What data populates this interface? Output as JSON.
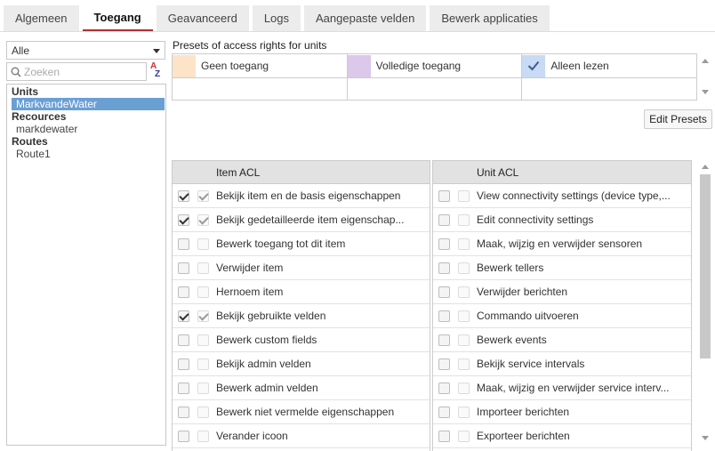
{
  "tabs": [
    {
      "label": "Algemeen",
      "active": false
    },
    {
      "label": "Toegang",
      "active": true
    },
    {
      "label": "Geavanceerd",
      "active": false
    },
    {
      "label": "Logs",
      "active": false
    },
    {
      "label": "Aangepaste velden",
      "active": false
    },
    {
      "label": "Bewerk applicaties",
      "active": false
    }
  ],
  "filter": {
    "selected": "Alle"
  },
  "search": {
    "placeholder": "Zoeken"
  },
  "sort_icon": {
    "top": "A",
    "bottom": "Z"
  },
  "tree": {
    "units_label": "Units",
    "unit_item": "MarkvandeWater",
    "resources_label": "Recources",
    "resource_item": "markdewater",
    "routes_label": "Routes",
    "route_item": "Route1"
  },
  "presets": {
    "title": "Presets of access rights for units",
    "items": [
      {
        "label": "Geen toegang",
        "color": "#fde3c8"
      },
      {
        "label": "Volledige toegang",
        "color": "#dcc8ea"
      },
      {
        "label": "Alleen lezen",
        "color": "#c8daf4",
        "checked": true
      }
    ]
  },
  "edit_presets_label": "Edit Presets",
  "item_acl": {
    "header": "Item ACL",
    "rows": [
      {
        "label": "Bekijk item en de basis eigenschappen",
        "checked": true
      },
      {
        "label": "Bekijk gedetailleerde item eigenschap...",
        "checked": true
      },
      {
        "label": "Bewerk toegang tot dit item",
        "checked": false
      },
      {
        "label": "Verwijder item",
        "checked": false
      },
      {
        "label": "Hernoem item",
        "checked": false
      },
      {
        "label": "Bekijk gebruikte velden",
        "checked": true
      },
      {
        "label": "Bewerk custom fields",
        "checked": false
      },
      {
        "label": "Bekijk admin velden",
        "checked": false
      },
      {
        "label": "Bewerk admin velden",
        "checked": false
      },
      {
        "label": "Bewerk niet vermelde eigenschappen",
        "checked": false
      },
      {
        "label": "Verander icoon",
        "checked": false
      }
    ]
  },
  "unit_acl": {
    "header": "Unit ACL",
    "rows": [
      {
        "label": "View connectivity settings (device type,...",
        "checked": false
      },
      {
        "label": "Edit connectivity settings",
        "checked": false
      },
      {
        "label": "Maak, wijzig en verwijder sensoren",
        "checked": false
      },
      {
        "label": "Bewerk tellers",
        "checked": false
      },
      {
        "label": "Verwijder berichten",
        "checked": false
      },
      {
        "label": "Commando uitvoeren",
        "checked": false
      },
      {
        "label": "Bewerk events",
        "checked": false
      },
      {
        "label": "Bekijk service intervals",
        "checked": false
      },
      {
        "label": "Maak, wijzig en verwijder service interv...",
        "checked": false
      },
      {
        "label": "Importeer berichten",
        "checked": false
      },
      {
        "label": "Exporteer berichten",
        "checked": false
      }
    ]
  }
}
